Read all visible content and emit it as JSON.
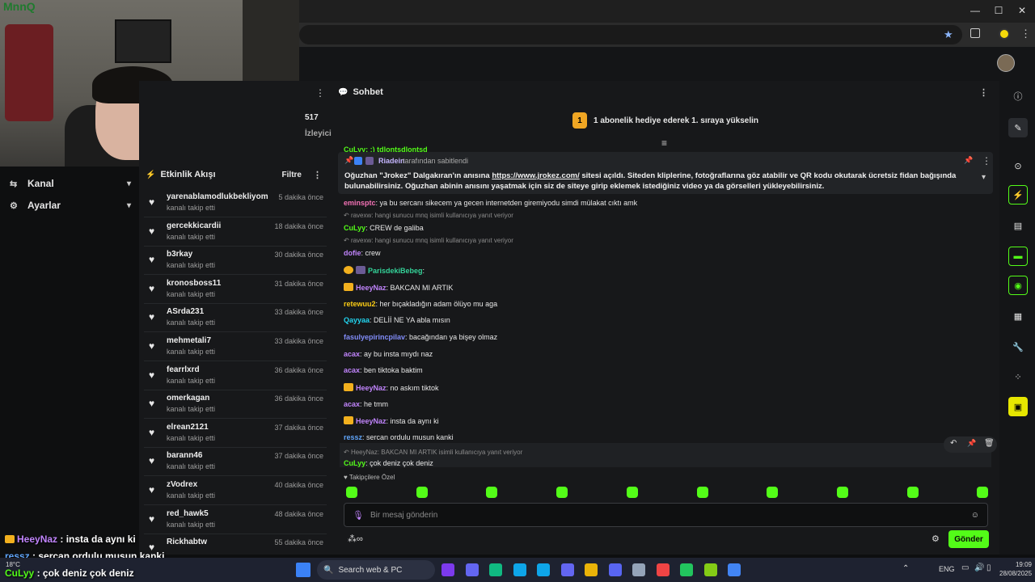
{
  "browser": {
    "win_min": "—",
    "win_max": "☐",
    "win_close": "✕"
  },
  "webcam": {
    "logo": "MnnQ"
  },
  "overlay_chat": [
    {
      "user": "HeeyNaz",
      "text": " : insta da aynı ki",
      "color": "#c084fc"
    },
    {
      "user": "ressz",
      "text": " : sercan ordulu musun kanki",
      "color": "#60a5fa"
    },
    {
      "user": "CuLyy",
      "text": " : çok deniz çok deniz",
      "color": "#53fc18"
    }
  ],
  "sidebar": {
    "items": [
      {
        "label": "Kanal",
        "icon": "channel-icon"
      },
      {
        "label": "Ayarlar",
        "icon": "gear-icon"
      }
    ]
  },
  "stats": {
    "value": "517",
    "label": "İzleyici"
  },
  "feed": {
    "title": "Etkinlik Akışı",
    "filter": "Filtre",
    "rows": [
      {
        "user": "yarenablamodlukbekliyom",
        "action": "kanalı takip etti",
        "time": "5 dakika önce"
      },
      {
        "user": "gercekkicardii",
        "action": "kanalı takip etti",
        "time": "18 dakika önce"
      },
      {
        "user": "b3rkay",
        "action": "kanalı takip etti",
        "time": "30 dakika önce"
      },
      {
        "user": "kronosboss11",
        "action": "kanalı takip etti",
        "time": "31 dakika önce"
      },
      {
        "user": "ASrda231",
        "action": "kanalı takip etti",
        "time": "33 dakika önce"
      },
      {
        "user": "mehmetali7",
        "action": "kanalı takip etti",
        "time": "33 dakika önce"
      },
      {
        "user": "fearrlxrd",
        "action": "kanalı takip etti",
        "time": "36 dakika önce"
      },
      {
        "user": "omerkagan",
        "action": "kanalı takip etti",
        "time": "36 dakika önce"
      },
      {
        "user": "elrean2121",
        "action": "kanalı takip etti",
        "time": "37 dakika önce"
      },
      {
        "user": "barann46",
        "action": "kanalı takip etti",
        "time": "37 dakika önce"
      },
      {
        "user": "zVodrex",
        "action": "kanalı takip etti",
        "time": "40 dakika önce"
      },
      {
        "user": "red_hawk5",
        "action": "kanalı takip etti",
        "time": "48 dakika önce"
      },
      {
        "user": "Rickhabtw",
        "action": "",
        "time": "55 dakika önce"
      }
    ]
  },
  "chat": {
    "title": "Sohbet",
    "gift_badge": "1",
    "gift_text": "1 abonelik hediye ederek 1. sıraya yükselin",
    "cut_message": "CuLyy: :) tdlontsdlontsd",
    "pinned": {
      "by_user": "Riadein",
      "by_text": "tarafından sabitlendi",
      "text_before": "Oğuzhan \"Jrokez\" Dalgakıran'ın anısına ",
      "link": "https://www.jrokez.com/",
      "text_after": " sitesi açıldı. Siteden kliplerine, fotoğraflarına göz atabilir ve QR kodu okutarak ücretsiz fidan bağışında bulunabilirsiniz. Oğuzhan abinin anısını yaşatmak için siz de siteye girip eklemek istediğiniz video ya da görselleri yükleyebilirsiniz."
    },
    "messages": [
      {
        "user": "eminsptc",
        "text": ": ya bu sercanı sikecem ya gecen internetden giremiyodu simdi mülakat cıktı amk",
        "color": "#f472b6"
      },
      {
        "reply": "ravexw: hangi sunucu mnq isimli kullanıcıya yanıt veriyor"
      },
      {
        "user": "CuLyy",
        "text": ": CREW de galiba",
        "color": "#53fc18"
      },
      {
        "reply": "ravexw: hangi sunucu mnq isimli kullanıcıya yanıt veriyor"
      },
      {
        "user": "dofie",
        "text": ": crew",
        "color": "#c084fc"
      },
      {
        "user": "ParisdekiBebeg",
        "text": ":",
        "color": "#34d399"
      },
      {
        "user": "HeeyNaz",
        "text": ": BAKCAN MI ARTIK",
        "color": "#c084fc"
      },
      {
        "user": "retewuu2",
        "text": ": her bıçakladığın adam ölüyo mu aga",
        "color": "#facc15"
      },
      {
        "user": "Qayyaa",
        "text": ": DELİİ NE YA abla mısın",
        "color": "#22d3ee"
      },
      {
        "user": "fasulyepirincpilav",
        "text": ": bacağından ya bişey olmaz",
        "color": "#818cf8"
      },
      {
        "user": "acax",
        "text": ": ay bu insta mıydı naz",
        "color": "#c084fc"
      },
      {
        "user": "acax",
        "text": ": ben tiktoka baktim",
        "color": "#c084fc"
      },
      {
        "user": "HeeyNaz",
        "text": ": no askım tiktok",
        "color": "#c084fc"
      },
      {
        "user": "acax",
        "text": ": he tmm",
        "color": "#c084fc"
      },
      {
        "user": "HeeyNaz",
        "text": ": insta da aynı ki",
        "color": "#c084fc"
      },
      {
        "user": "ressz",
        "text": ": sercan ordulu musun kanki",
        "color": "#60a5fa"
      },
      {
        "reply": "HeeyNaz: BAKCAN MI ARTIK isimli kullanıcıya yanıt veriyor"
      },
      {
        "user": "CuLyy",
        "text": ": çok deniz çok deniz",
        "color": "#53fc18"
      }
    ],
    "followers_label": "Takipçilere Özel",
    "input_placeholder": "Bir mesaj gönderin",
    "send_label": "Gönder"
  },
  "taskbar": {
    "search_placeholder": "Search web & PC",
    "weather": "18°C",
    "lang": "ENG",
    "time": "19:09",
    "date": "28/08/2025"
  }
}
